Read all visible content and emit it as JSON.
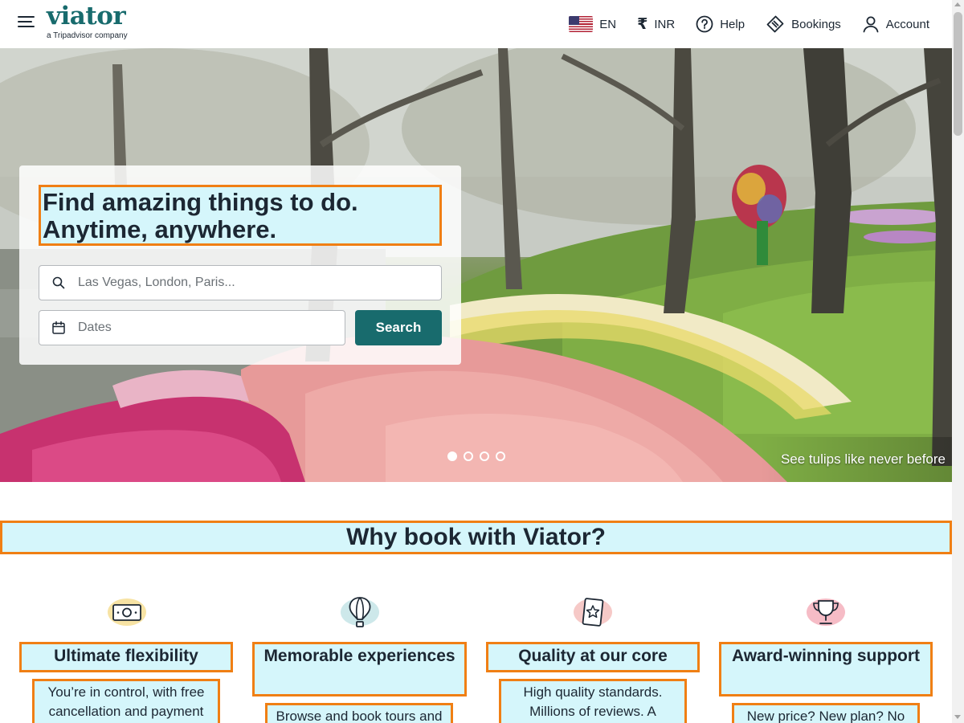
{
  "header": {
    "logo": "viator",
    "logo_tagline": "a Tripadvisor company",
    "language": "EN",
    "currency_symbol": "₹",
    "currency": "INR",
    "help": "Help",
    "bookings": "Bookings",
    "account": "Account"
  },
  "hero": {
    "title_line1": "Find amazing things to do.",
    "title_line2": "Anytime, anywhere.",
    "search_placeholder": "Las Vegas, London, Paris...",
    "search_value": "",
    "dates_placeholder": "Dates",
    "dates_value": "",
    "search_button": "Search",
    "caption": "See tulips like never before",
    "slides_total": 4,
    "active_slide": 1
  },
  "why": {
    "title": "Why book with Viator?",
    "features": [
      {
        "icon": "money-icon",
        "title": "Ultimate flexibility",
        "description": "You’re in control, with free cancellation and payment"
      },
      {
        "icon": "hot-air-balloon-icon",
        "title": "Memorable experiences",
        "description": "Browse and book tours and"
      },
      {
        "icon": "badge-star-icon",
        "title": "Quality at our core",
        "description": "High quality standards. Millions of reviews. A"
      },
      {
        "icon": "trophy-icon",
        "title": "Award-winning support",
        "description": "New price? New plan? No"
      }
    ]
  },
  "colors": {
    "brand": "#186b6d",
    "highlight_border": "#f07f14",
    "highlight_fill": "#d5f6fb",
    "text": "#1c2733"
  }
}
